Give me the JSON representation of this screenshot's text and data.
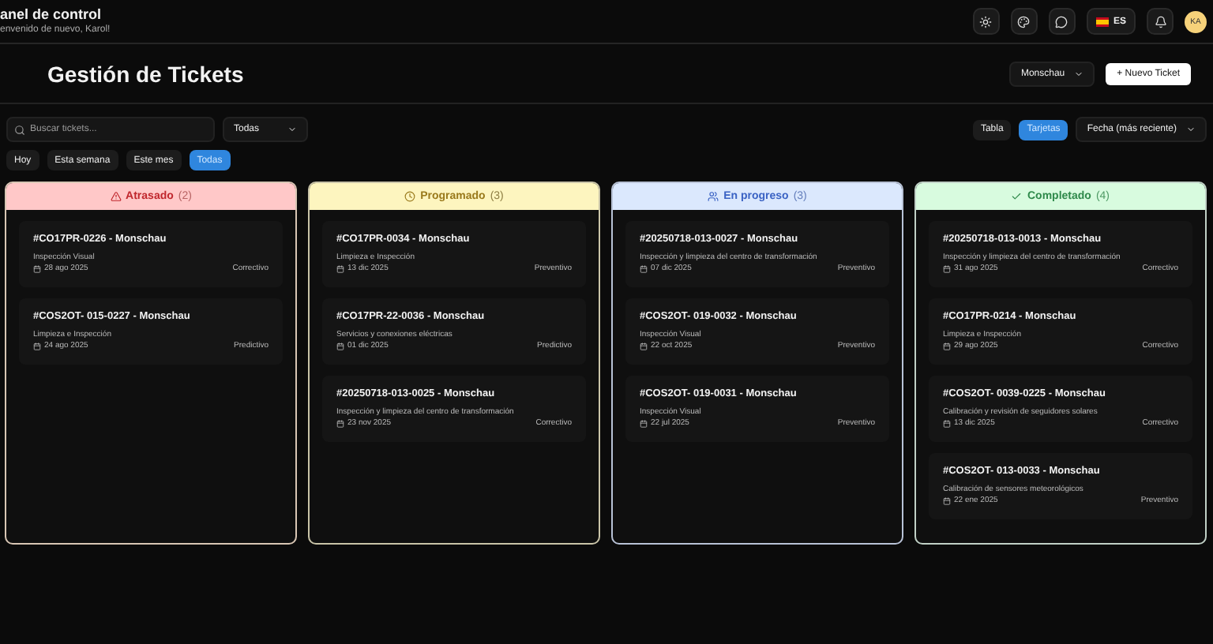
{
  "header": {
    "title": "anel de control",
    "subtitle": "envenido de nuevo, Karol!",
    "language": "ES",
    "avatar": "KA"
  },
  "page": {
    "title": "Gestión de Tickets",
    "site_select": "Monschau",
    "new_button": "+ Nuevo Ticket"
  },
  "filters": {
    "search": {
      "placeholder": "Buscar tickets..."
    },
    "type_select": "Todas",
    "views": [
      {
        "label": "Tabla",
        "selected": false
      },
      {
        "label": "Tarjetas",
        "selected": true
      }
    ],
    "sort_select": "Fecha (más reciente)",
    "periods": [
      {
        "label": "Hoy",
        "selected": false
      },
      {
        "label": "Esta semana",
        "selected": false
      },
      {
        "label": "Este mes",
        "selected": false
      },
      {
        "label": "Todas",
        "selected": true
      }
    ]
  },
  "columns": [
    {
      "kind": "overdue",
      "title": "Atrasado",
      "count": "(2)",
      "cards": [
        {
          "title": "#CO17PR-0226 - Monschau",
          "description": "Inspección Visual",
          "date": "28 ago 2025",
          "type": "Correctivo"
        },
        {
          "title": "#COS2OT- 015-0227 - Monschau",
          "description": "Limpieza e Inspección",
          "date": "24 ago 2025",
          "type": "Predictivo"
        }
      ]
    },
    {
      "kind": "scheduled",
      "title": "Programado",
      "count": "(3)",
      "cards": [
        {
          "title": "#CO17PR-0034 - Monschau",
          "description": "Limpieza e Inspección",
          "date": "13 dic 2025",
          "type": "Preventivo"
        },
        {
          "title": "#CO17PR-22-0036 - Monschau",
          "description": "Servicios y conexiones eléctricas",
          "date": "01 dic 2025",
          "type": "Predictivo"
        },
        {
          "title": "#20250718-013-0025 - Monschau",
          "description": "Inspección y limpieza del centro de transformación",
          "date": "23 nov 2025",
          "type": "Correctivo"
        }
      ]
    },
    {
      "kind": "progress",
      "title": "En progreso",
      "count": "(3)",
      "cards": [
        {
          "title": "#20250718-013-0027 - Monschau",
          "description": "Inspección y limpieza del centro de transformación",
          "date": "07 dic 2025",
          "type": "Preventivo"
        },
        {
          "title": "#COS2OT- 019-0032 - Monschau",
          "description": "Inspección Visual",
          "date": "22 oct 2025",
          "type": "Preventivo"
        },
        {
          "title": "#COS2OT- 019-0031 - Monschau",
          "description": "Inspección Visual",
          "date": "22 jul 2025",
          "type": "Preventivo"
        }
      ]
    },
    {
      "kind": "done",
      "title": "Completado",
      "count": "(4)",
      "cards": [
        {
          "title": "#20250718-013-0013 - Monschau",
          "description": "Inspección y limpieza del centro de transformación",
          "date": "31 ago 2025",
          "type": "Correctivo"
        },
        {
          "title": "#CO17PR-0214 - Monschau",
          "description": "Limpieza e Inspección",
          "date": "29 ago 2025",
          "type": "Correctivo"
        },
        {
          "title": "#COS2OT- 0039-0225 - Monschau",
          "description": "Calibración y revisión de seguidores solares",
          "date": "13 dic 2025",
          "type": "Correctivo"
        },
        {
          "title": "#COS2OT- 013-0033 - Monschau",
          "description": "Calibración de sensores meteorológicos",
          "date": "22 ene 2025",
          "type": "Preventivo"
        }
      ]
    }
  ]
}
